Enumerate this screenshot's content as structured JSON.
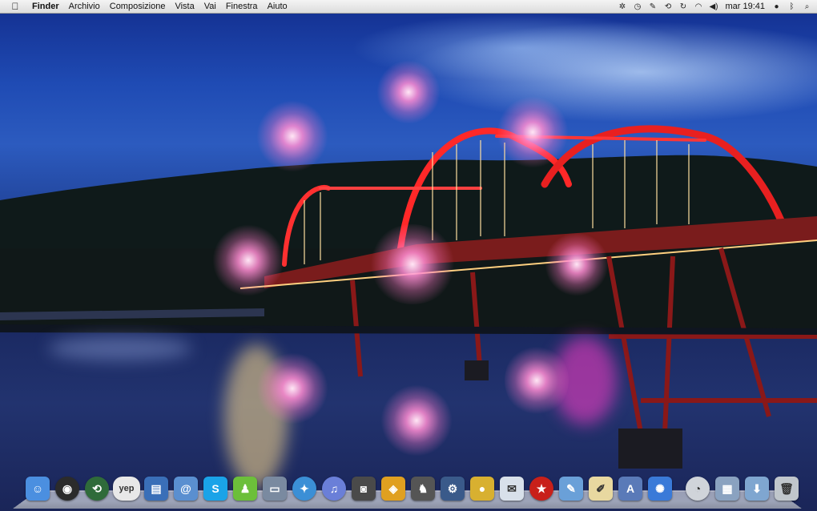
{
  "menubar": {
    "app_name": "Finder",
    "menus": [
      "Archivio",
      "Composizione",
      "Vista",
      "Vai",
      "Finestra",
      "Aiuto"
    ],
    "clock": "mar 19:41"
  },
  "status_icons": [
    "bluetooth-like-icon",
    "clock-history-icon",
    "wrench-icon",
    "time-machine-icon",
    "sync-icon",
    "wifi-icon",
    "volume-icon",
    "clock-text",
    "user-icon",
    "spotlight-search-icon"
  ],
  "dock": {
    "apps": [
      {
        "name": "finder",
        "glyph": "☺",
        "color": "#4b8fe0"
      },
      {
        "name": "dashboard",
        "glyph": "◉",
        "color": "#2b2b2b"
      },
      {
        "name": "time-machine",
        "glyph": "⟲",
        "color": "#2f6b3a"
      },
      {
        "name": "yep",
        "glyph": "yep",
        "color": "#e8e8e8"
      },
      {
        "name": "preview",
        "glyph": "▤",
        "color": "#3a6fb8"
      },
      {
        "name": "mail",
        "glyph": "@",
        "color": "#5a8fd0"
      },
      {
        "name": "skype",
        "glyph": "S",
        "color": "#1aa3e8"
      },
      {
        "name": "android-app",
        "glyph": "♟",
        "color": "#6cbf3a"
      },
      {
        "name": "ipad-app",
        "glyph": "▭",
        "color": "#7a8aa0"
      },
      {
        "name": "safari",
        "glyph": "✦",
        "color": "#3b8fd6"
      },
      {
        "name": "itunes",
        "glyph": "♫",
        "color": "#6a7fd8"
      },
      {
        "name": "iphoto",
        "glyph": "◙",
        "color": "#4a4a4a"
      },
      {
        "name": "color-app",
        "glyph": "◈",
        "color": "#e0a020"
      },
      {
        "name": "chess",
        "glyph": "♞",
        "color": "#555"
      },
      {
        "name": "xcode",
        "glyph": "⚙",
        "color": "#3a5a8a"
      },
      {
        "name": "coins-app",
        "glyph": "●",
        "color": "#d8b030"
      },
      {
        "name": "mail-stamp",
        "glyph": "✉",
        "color": "#d8e0ea"
      },
      {
        "name": "star-app",
        "glyph": "★",
        "color": "#c8201a"
      },
      {
        "name": "utility",
        "glyph": "✎",
        "color": "#6aa0d8"
      },
      {
        "name": "textedit",
        "glyph": "✐",
        "color": "#e8d8a0"
      },
      {
        "name": "app-store",
        "glyph": "A",
        "color": "#5a7ab8"
      },
      {
        "name": "sparkle-app",
        "glyph": "✺",
        "color": "#3a7ad8"
      }
    ],
    "stacks": [
      {
        "name": "clock-utility",
        "glyph": "◔",
        "color": "#d0d4da"
      },
      {
        "name": "pictures-folder",
        "glyph": "▦",
        "color": "#8aa2c0"
      },
      {
        "name": "downloads-folder",
        "glyph": "⬇",
        "color": "#7fa6d0"
      },
      {
        "name": "trash",
        "glyph": "🗑",
        "color": "#c0c6cc"
      }
    ]
  }
}
